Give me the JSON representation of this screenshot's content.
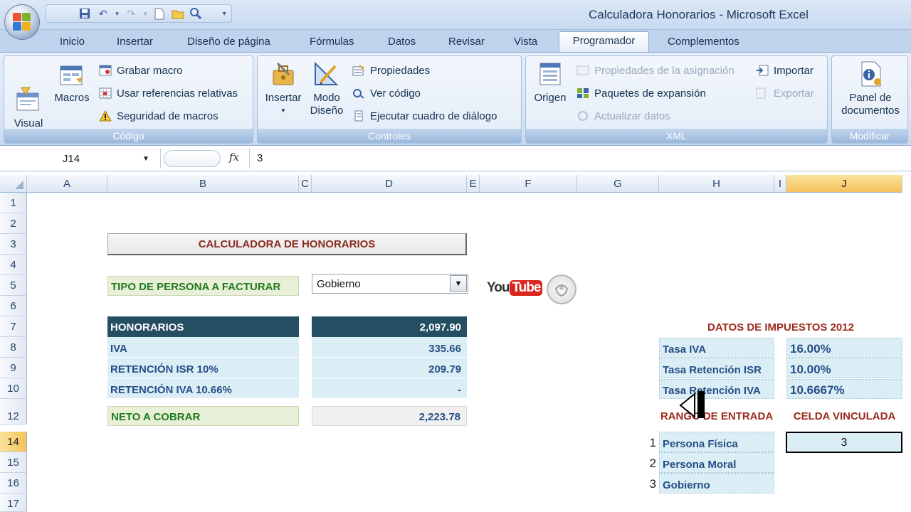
{
  "window": {
    "title": "Calculadora Honorarios - Microsoft Excel"
  },
  "ribbon": {
    "tabs": [
      {
        "label": "Inicio"
      },
      {
        "label": "Insertar"
      },
      {
        "label": "Diseño de página"
      },
      {
        "label": "Fórmulas"
      },
      {
        "label": "Datos"
      },
      {
        "label": "Revisar"
      },
      {
        "label": "Vista"
      },
      {
        "label": "Programador"
      },
      {
        "label": "Complementos"
      }
    ],
    "active_tab": "Programador",
    "groups": {
      "codigo": {
        "label": "Código",
        "visual_basic": "Visual\nBasic",
        "macros": "Macros",
        "grabar_macro": "Grabar macro",
        "referencias_relativas": "Usar referencias relativas",
        "seguridad": "Seguridad de macros"
      },
      "controles": {
        "label": "Controles",
        "insertar": "Insertar",
        "modo_diseno": "Modo\nDiseño",
        "propiedades": "Propiedades",
        "ver_codigo": "Ver código",
        "ejecutar_cuadro": "Ejecutar cuadro de diálogo"
      },
      "xml": {
        "label": "XML",
        "origen": "Origen",
        "propiedades_asignacion": "Propiedades de la asignación",
        "paquetes_expansion": "Paquetes de expansión",
        "actualizar_datos": "Actualizar datos",
        "importar": "Importar",
        "exportar": "Exportar"
      },
      "modificar": {
        "label": "Modificar",
        "panel_documentos": "Panel de\ndocumentos"
      }
    }
  },
  "formula_bar": {
    "name_box": "J14",
    "fx": "fx",
    "value": "3"
  },
  "grid": {
    "columns": [
      "A",
      "B",
      "C",
      "D",
      "E",
      "F",
      "G",
      "H",
      "I",
      "J"
    ],
    "selected_column": "J",
    "rows": [
      "1",
      "2",
      "3",
      "4",
      "5",
      "6",
      "7",
      "8",
      "9",
      "10",
      "12",
      "14",
      "15",
      "16",
      "17"
    ],
    "selected_row": "14"
  },
  "sheet": {
    "title": "CALCULADORA DE HONORARIOS",
    "tipo_persona_label": "TIPO DE PERSONA A FACTURAR",
    "tipo_persona_value": "Gobierno",
    "honorarios_label": "HONORARIOS",
    "honorarios_value": "2,097.90",
    "iva_label": "IVA",
    "iva_value": "335.66",
    "ret_isr_label": "RETENCIÓN ISR  10%",
    "ret_isr_value": "209.79",
    "ret_iva_label": "RETENCIÓN IVA 10.66%",
    "ret_iva_value": "-",
    "neto_label": "NETO A COBRAR",
    "neto_value": "2,223.78",
    "youtube_you": "You",
    "youtube_tube": "Tube",
    "impuestos_title": "DATOS DE IMPUESTOS 2012",
    "tasa_iva_label": "Tasa IVA",
    "tasa_iva_value": "16.00%",
    "tasa_ret_isr_label": "Tasa Retención ISR",
    "tasa_ret_isr_value": "10.00%",
    "tasa_ret_iva_label": "Tasa Retención IVA",
    "tasa_ret_iva_value": "10.6667%",
    "rango_entrada_label": "RANGO DE ENTRADA",
    "celda_vinculada_label": "CELDA VINCULADA",
    "celda_vinculada_value": "3",
    "opciones": [
      {
        "idx": "1",
        "label": "Persona Física"
      },
      {
        "idx": "2",
        "label": "Persona Moral"
      },
      {
        "idx": "3",
        "label": "Gobierno"
      }
    ]
  }
}
